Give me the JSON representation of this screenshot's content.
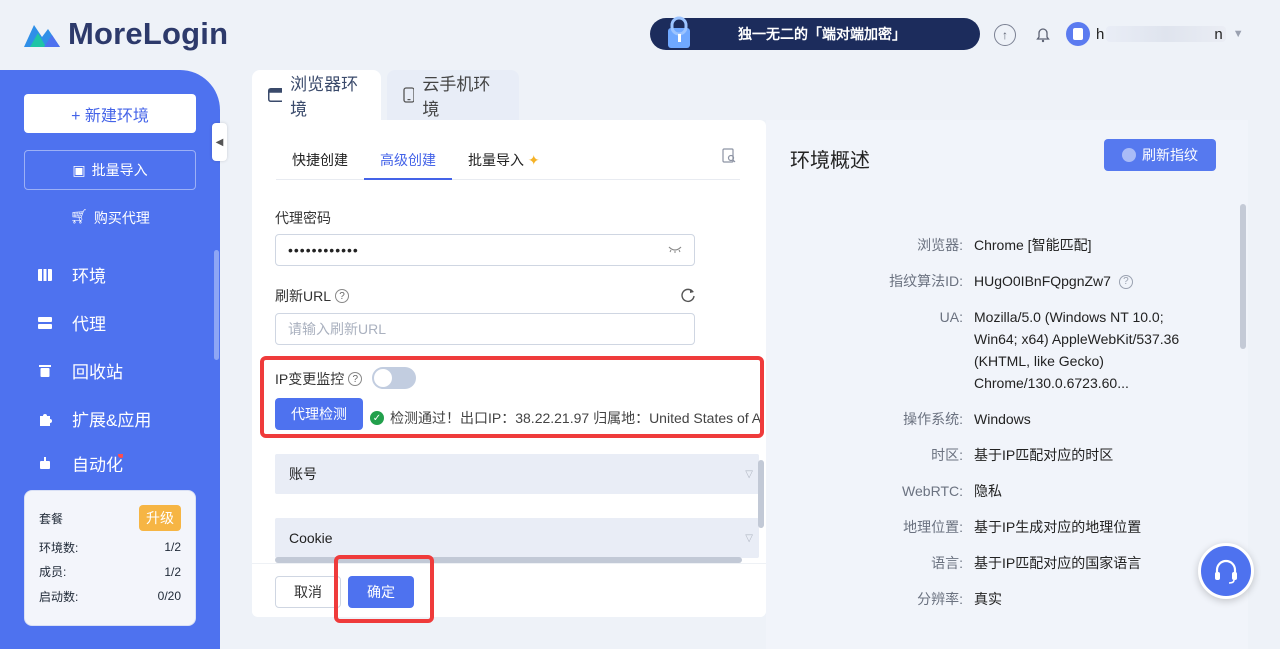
{
  "app": {
    "brand": "MoreLogin"
  },
  "header": {
    "promo_text": "独一无二的「端对端加密」",
    "user_initial": "h",
    "user_suffix": "n"
  },
  "sidebar": {
    "new_env_label": "+ 新建环境",
    "batch_import_label": "批量导入",
    "buy_proxy_label": "购买代理",
    "items": [
      {
        "label": "环境",
        "icon": "grid-icon"
      },
      {
        "label": "代理",
        "icon": "server-icon"
      },
      {
        "label": "回收站",
        "icon": "trash-icon"
      },
      {
        "label": "扩展&应用",
        "icon": "puzzle-icon"
      },
      {
        "label": "自动化",
        "icon": "robot-icon"
      }
    ],
    "plan": {
      "title": "套餐",
      "upgrade_label": "升级",
      "rows": [
        {
          "label": "环境数:",
          "value": "1/2"
        },
        {
          "label": "成员:",
          "value": "1/2"
        },
        {
          "label": "启动数:",
          "value": "0/20"
        }
      ]
    }
  },
  "env_tabs": [
    {
      "label": "浏览器环境",
      "active": true
    },
    {
      "label": "云手机环境",
      "active": false
    }
  ],
  "form": {
    "subtabs": [
      {
        "label": "快捷创建",
        "active": false
      },
      {
        "label": "高级创建",
        "active": true
      },
      {
        "label": "批量导入",
        "active": false
      }
    ],
    "proxy_password_label": "代理密码",
    "proxy_password_value": "••••••••••••",
    "refresh_url_label": "刷新URL",
    "refresh_url_placeholder": "请输入刷新URL",
    "ip_monitor_label": "IP变更监控",
    "ip_monitor_enabled": false,
    "proxy_check_label": "代理检测",
    "check_result": "检测通过！出口IP：38.22.21.97 归属地：United States of A",
    "sections": [
      "账号",
      "Cookie"
    ],
    "cancel_label": "取消",
    "confirm_label": "确定"
  },
  "overview": {
    "title": "环境概述",
    "refresh_fp_label": "刷新指纹",
    "rows": [
      {
        "key": "浏览器:",
        "value": "Chrome [智能匹配]"
      },
      {
        "key": "指纹算法ID:",
        "value": "HUgO0IBnFQpgnZw7"
      },
      {
        "key": "UA:",
        "value": "Mozilla/5.0 (Windows NT 10.0; Win64; x64) AppleWebKit/537.36 (KHTML, like Gecko) Chrome/130.0.6723.60..."
      },
      {
        "key": "操作系统:",
        "value": "Windows"
      },
      {
        "key": "时区:",
        "value": "基于IP匹配对应的时区"
      },
      {
        "key": "WebRTC:",
        "value": "隐私"
      },
      {
        "key": "地理位置:",
        "value": "基于IP生成对应的地理位置"
      },
      {
        "key": "语言:",
        "value": "基于IP匹配对应的国家语言"
      },
      {
        "key": "分辨率:",
        "value": "真实"
      }
    ]
  },
  "colors": {
    "primary": "#4e72ef",
    "highlight": "#ef3b3b",
    "success": "#22a04c",
    "upgrade": "#f6b544"
  }
}
